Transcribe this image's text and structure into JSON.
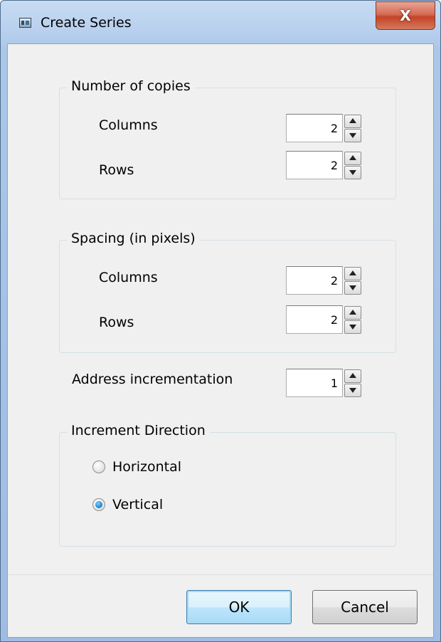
{
  "window": {
    "title": "Create Series",
    "close_label": "X",
    "icon": "app-window-icon"
  },
  "copies": {
    "legend": "Number of copies",
    "columns_label": "Columns",
    "columns_value": "2",
    "rows_label": "Rows",
    "rows_value": "2"
  },
  "spacing": {
    "legend": "Spacing (in pixels)",
    "columns_label": "Columns",
    "columns_value": "2",
    "rows_label": "Rows",
    "rows_value": "2"
  },
  "address": {
    "label": "Address incrementation",
    "value": "1"
  },
  "direction": {
    "legend": "Increment Direction",
    "options": [
      {
        "label": "Horizontal",
        "checked": false
      },
      {
        "label": "Vertical",
        "checked": true
      }
    ]
  },
  "buttons": {
    "ok_label": "OK",
    "cancel_label": "Cancel"
  },
  "colors": {
    "title_bar": "#b9d1ee",
    "close_button": "#c44427",
    "dialog_background": "#f0f0f0",
    "default_button": "#bee6fd"
  }
}
